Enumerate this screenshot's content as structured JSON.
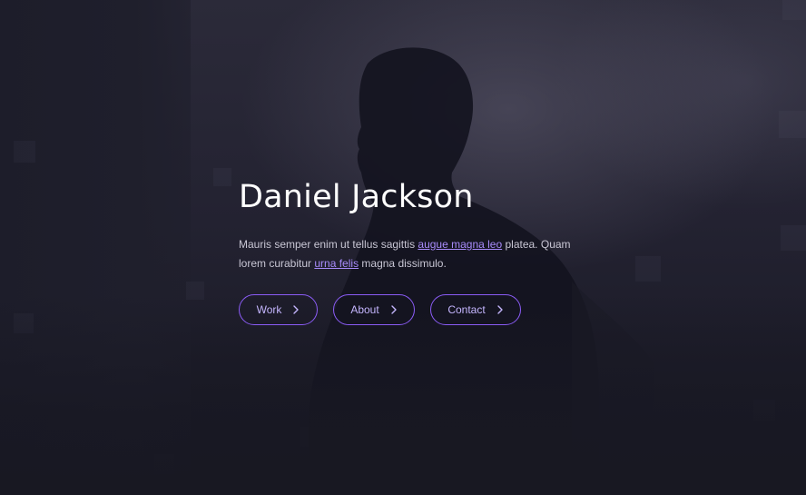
{
  "hero": {
    "title": "Daniel Jackson",
    "description": {
      "part1": "Mauris semper enim ut tellus sagittis ",
      "link1": "augue magna leo",
      "part2": " platea. Quam lorem curabitur ",
      "link2": "urna felis",
      "part3": " magna dissimulo."
    },
    "buttons": [
      {
        "label": "Work",
        "icon": "chevron-right-icon"
      },
      {
        "label": "About",
        "icon": "chevron-right-icon"
      },
      {
        "label": "Contact",
        "icon": "chevron-right-icon"
      }
    ]
  },
  "colors": {
    "accent": "#8b5cf6",
    "link": "#a78bfa",
    "background": "#1a1a26"
  }
}
